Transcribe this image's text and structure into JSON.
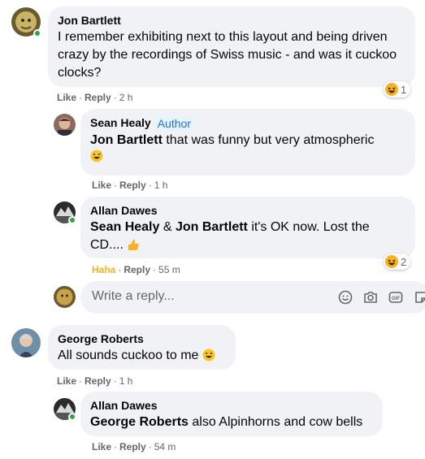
{
  "comments": [
    {
      "author": "Jon Bartlett",
      "text": "I remember exhibiting next to this layout and being driven crazy by the recordings of Swiss music - and was it cuckoo clocks?",
      "actions": {
        "like": "Like",
        "reply": "Reply",
        "time": "2 h"
      },
      "reaction": {
        "icon": "haha-emoji-icon",
        "count": "1"
      },
      "online": true,
      "replies": [
        {
          "author": "Sean Healy",
          "badge": "Author",
          "mention": "Jon Bartlett",
          "text": "that was funny but very atmospheric",
          "emoji": "grinning-sweat-emoji-icon",
          "actions": {
            "like": "Like",
            "reply": "Reply",
            "time": "1 h"
          }
        },
        {
          "author": "Allan Dawes",
          "mention1": "Sean Healy",
          "amp": "&",
          "mention2": "Jon Bartlett",
          "text": "it's OK now. Lost the CD....",
          "emoji": "thumbs-up-emoji-icon",
          "actions": {
            "like": "Haha",
            "reply": "Reply",
            "time": "55 m"
          },
          "reaction": {
            "icon": "haha-emoji-icon",
            "count": "2"
          },
          "online": true
        }
      ]
    },
    {
      "author": "George Roberts",
      "text": "All sounds cuckoo to me",
      "emoji": "laughing-emoji-icon",
      "actions": {
        "like": "Like",
        "reply": "Reply",
        "time": "1 h"
      },
      "replies": [
        {
          "author": "Allan Dawes",
          "mention": "George Roberts",
          "text": "also Alpinhorns and cow bells",
          "actions": {
            "like": "Like",
            "reply": "Reply",
            "time": "54 m"
          },
          "online": true
        }
      ]
    }
  ],
  "reply_box": {
    "placeholder": "Write a reply...",
    "tools": [
      "smiley-icon",
      "camera-icon",
      "gif-icon",
      "sticker-icon"
    ]
  },
  "separator": "·",
  "colors": {
    "bubble": "#f0f2f5",
    "haha": "#f7b125",
    "online": "#31a24c",
    "badge_text": "#216fdb"
  }
}
